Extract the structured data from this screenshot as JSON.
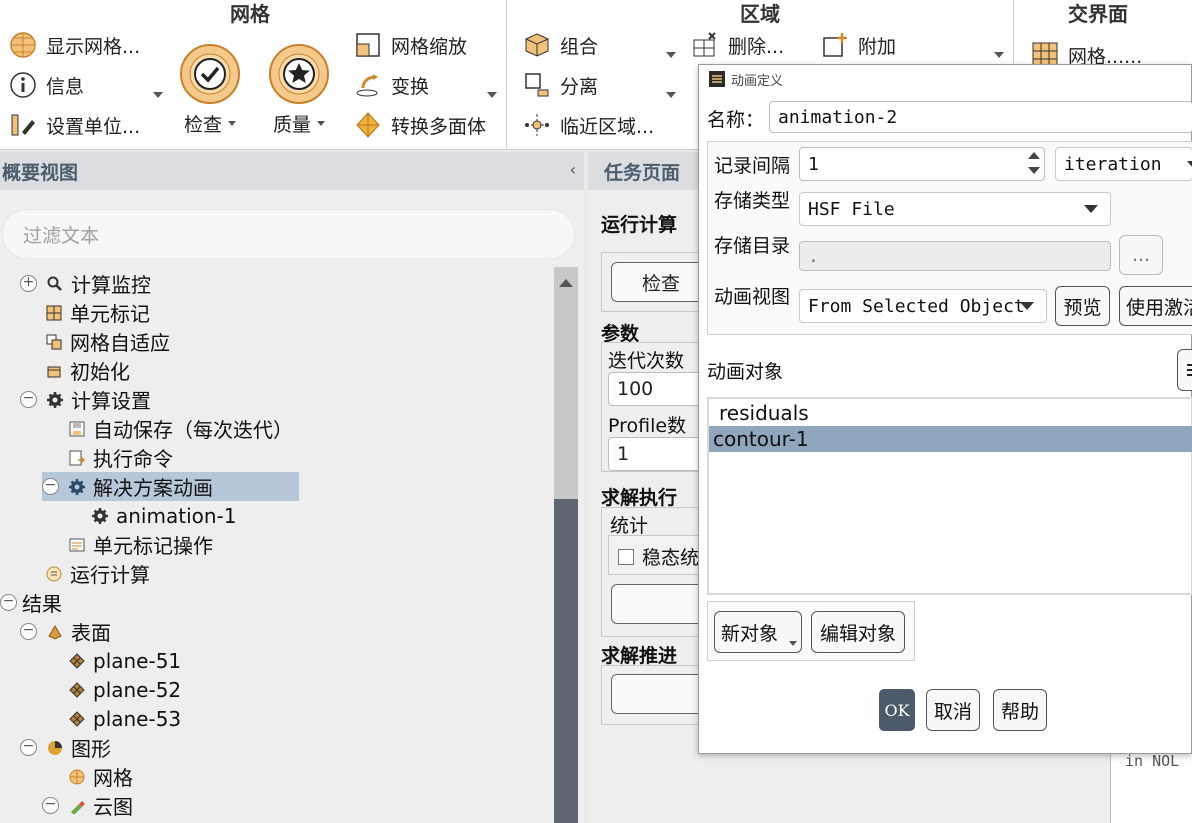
{
  "ribbon": {
    "mesh_group_title": "网格",
    "zone_group_title": "区域",
    "interface_group_title": "交界面",
    "display_mesh": "显示网格...",
    "info": "信息",
    "set_units": "设置单位...",
    "check": "检查",
    "quality": "质量",
    "mesh_scale": "网格缩放",
    "transform": "变换",
    "convert_polyhedra": "转换多面体",
    "combine": "组合",
    "separate": "分离",
    "adjacency": "临近区域...",
    "delete": "删除...",
    "append": "附加",
    "interface_mesh": "网格......"
  },
  "outline": {
    "title": "概要视图",
    "collapse": "‹",
    "filter_placeholder": "过滤文本",
    "tree": [
      {
        "label": "计算监控"
      },
      {
        "label": "单元标记"
      },
      {
        "label": "网格自适应"
      },
      {
        "label": "初始化"
      },
      {
        "label": "计算设置"
      },
      {
        "label": "自动保存（每次迭代）"
      },
      {
        "label": "执行命令"
      },
      {
        "label": "解决方案动画"
      },
      {
        "label": "animation-1"
      },
      {
        "label": "单元标记操作"
      },
      {
        "label": "运行计算"
      },
      {
        "label": "结果"
      },
      {
        "label": "表面"
      },
      {
        "label": "plane-51"
      },
      {
        "label": "plane-52"
      },
      {
        "label": "plane-53"
      },
      {
        "label": "图形"
      },
      {
        "label": "网格"
      },
      {
        "label": "云图"
      }
    ]
  },
  "task": {
    "title": "任务页面",
    "run_calc": "运行计算",
    "check_btn": "检查",
    "params": "参数",
    "iterations_label": "迭代次数",
    "iterations_value": "100",
    "profile_label": "Profile数",
    "profile_value": "1",
    "solve_exec": "求解执行",
    "stats": "统计",
    "steady_stats": "稳态统",
    "solve_advance": "求解推进",
    "console_text": "in NOL"
  },
  "dialog": {
    "title": "动画定义",
    "name_label": "名称：",
    "name_value": "animation-2",
    "interval_label": "记录间隔",
    "interval_value": "1",
    "interval_unit": "iteration",
    "storage_type_label": "存储类型",
    "storage_type_value": "HSF File",
    "storage_dir_label": "存储目录",
    "storage_dir_value": ".",
    "browse": "...",
    "view_label": "动画视图",
    "view_value": "From Selected Object",
    "preview": "预览",
    "use_active": "使用激活",
    "objects_label": "动画对象",
    "objects": [
      "residuals",
      "contour-1"
    ],
    "new_object": "新对象",
    "edit_object": "编辑对象",
    "ok": "OK",
    "cancel": "取消",
    "help": "帮助"
  },
  "colors": {
    "selection": "#b6c7d9",
    "list_selection": "#8fa6bd",
    "ok_button": "#4d5a6b",
    "scroll_thumb": "#5f6673"
  }
}
